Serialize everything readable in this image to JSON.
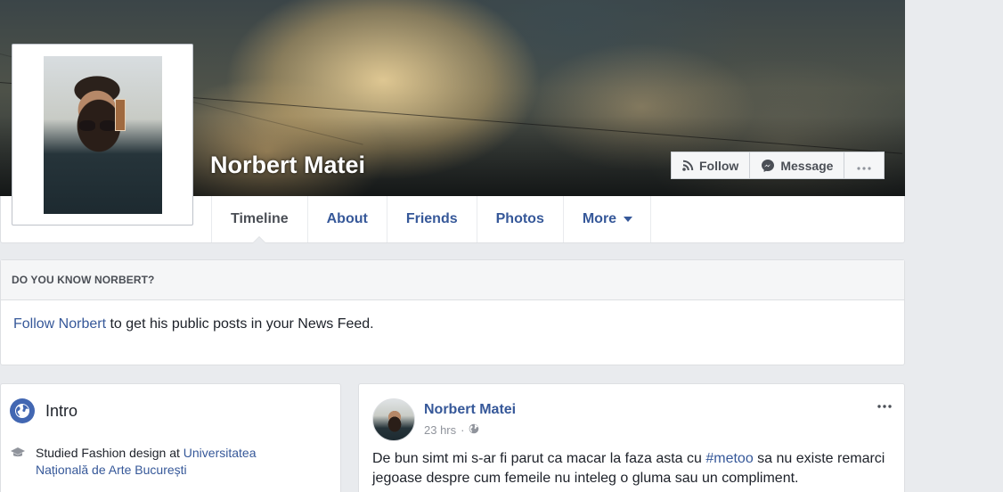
{
  "profile": {
    "name": "Norbert Matei",
    "actions": {
      "follow_label": "Follow",
      "message_label": "Message"
    }
  },
  "nav": {
    "tabs": [
      {
        "label": "Timeline",
        "active": true
      },
      {
        "label": "About"
      },
      {
        "label": "Friends"
      },
      {
        "label": "Photos"
      },
      {
        "label": "More"
      }
    ]
  },
  "know": {
    "heading": "DO YOU KNOW NORBERT?",
    "link": "Follow Norbert",
    "text": " to get his public posts in your News Feed."
  },
  "intro": {
    "title": "Intro",
    "education": {
      "prefix": "Studied Fashion design at ",
      "school": "Universitatea Națională de Arte București"
    }
  },
  "post": {
    "author": "Norbert Matei",
    "time": "23 hrs",
    "separator": "·",
    "text_before": "De bun simt mi s-ar fi parut ca macar la faza asta cu ",
    "hashtag": "#metoo",
    "text_after": " sa nu existe remarci jegoase despre cum femeile nu inteleg o gluma sau un compliment."
  },
  "colors": {
    "link": "#365899",
    "background": "#e9ebee",
    "brand": "#4267b2"
  },
  "icons": [
    "rss-icon",
    "messenger-icon",
    "more-dots-icon",
    "globe-icon",
    "graduation-cap-icon",
    "public-globe-icon",
    "dropdown-caret-icon"
  ]
}
